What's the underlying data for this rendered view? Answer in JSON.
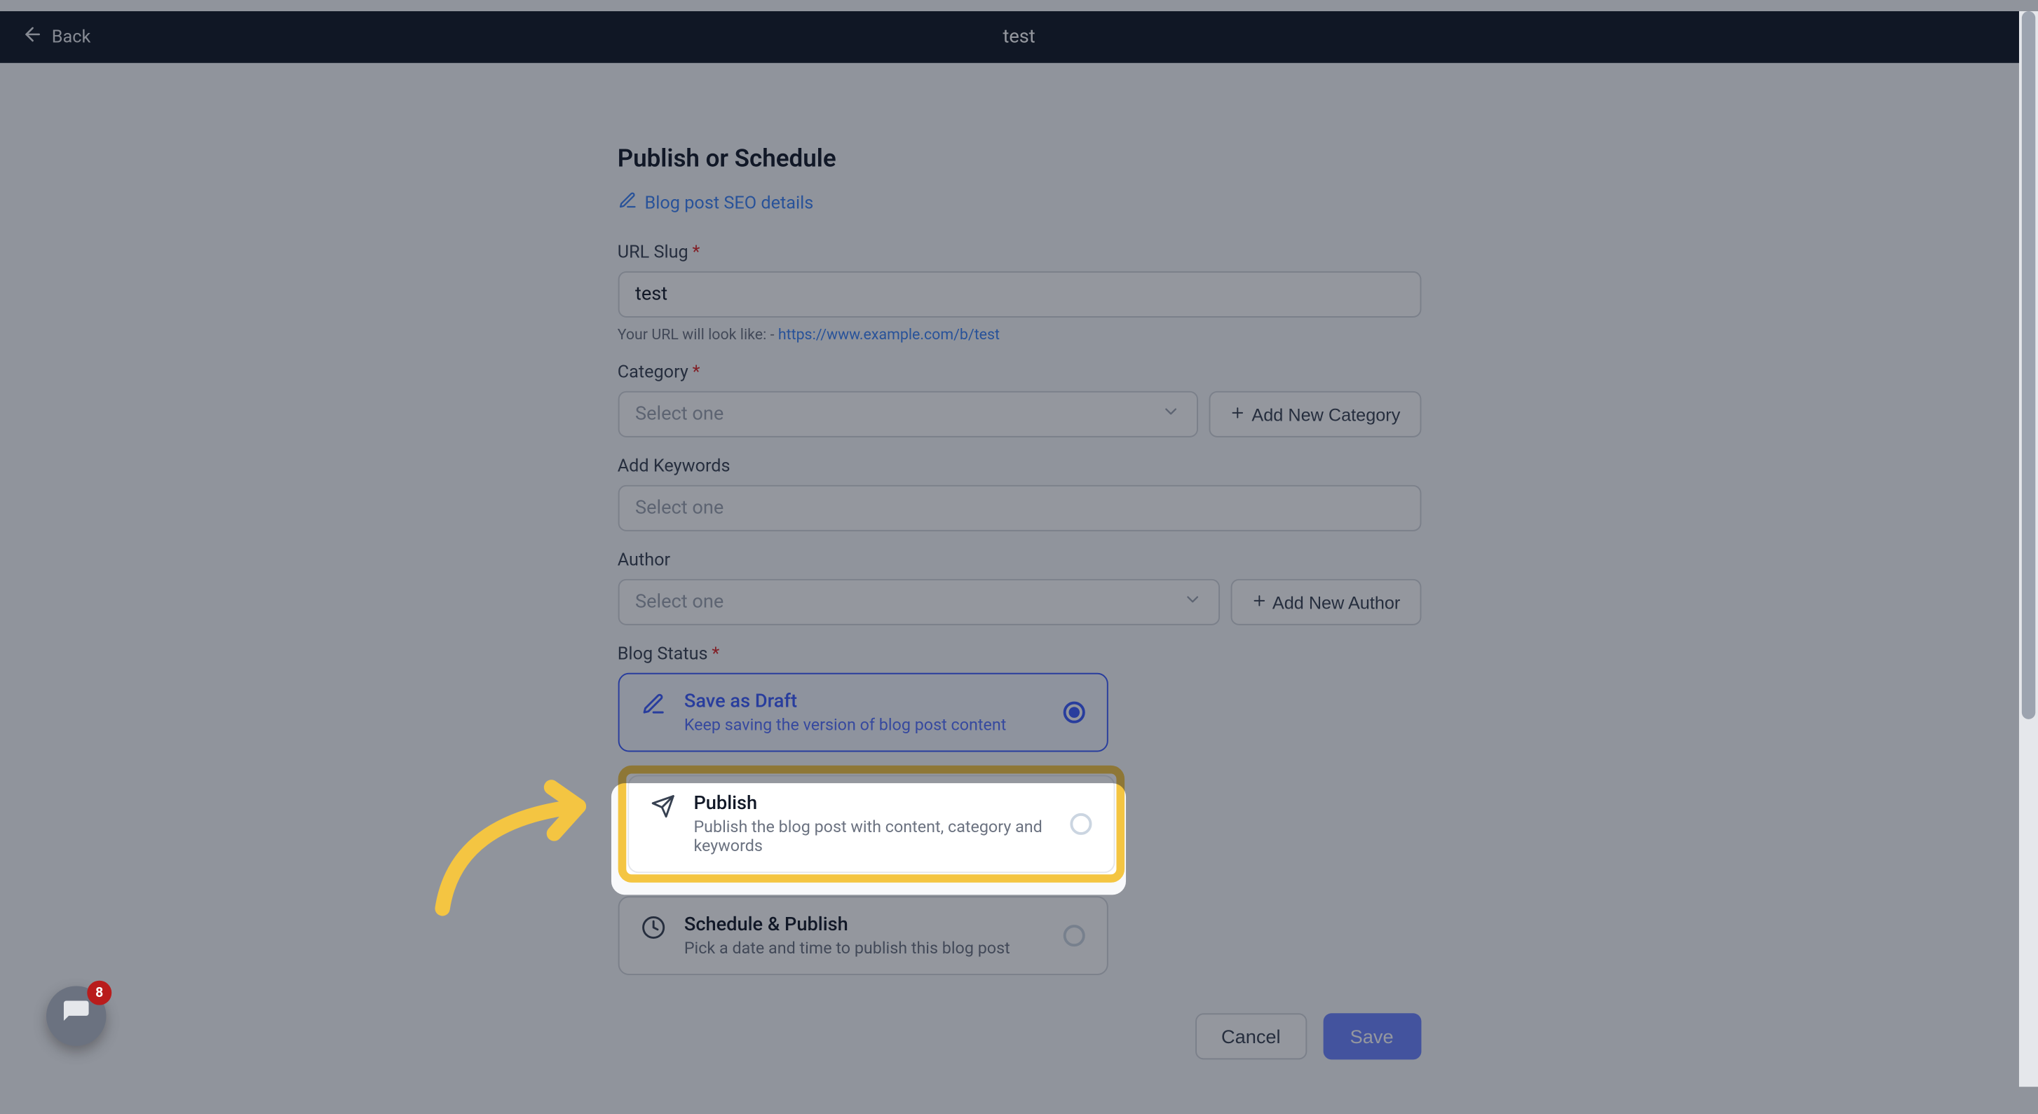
{
  "header": {
    "back_label": "Back",
    "title": "test"
  },
  "page_title": "Publish or Schedule",
  "seo_link": "Blog post SEO details",
  "url_slug": {
    "label": "URL Slug",
    "value": "test",
    "hint_prefix": "Your URL will look like: - ",
    "hint_url": "https://www.example.com/b/test"
  },
  "category": {
    "label": "Category",
    "placeholder": "Select one",
    "add_button": "Add New Category"
  },
  "keywords": {
    "label": "Add Keywords",
    "placeholder": "Select one"
  },
  "author": {
    "label": "Author",
    "placeholder": "Select one",
    "add_button": "Add New Author"
  },
  "blog_status": {
    "label": "Blog Status",
    "options": [
      {
        "title": "Save as Draft",
        "desc": "Keep saving the version of blog post content",
        "selected": true,
        "icon": "pencil"
      },
      {
        "title": "Publish",
        "desc": "Publish the blog post with content, category and keywords",
        "selected": false,
        "icon": "send",
        "highlighted": true
      },
      {
        "title": "Schedule & Publish",
        "desc": "Pick a date and time to publish this blog post",
        "selected": false,
        "icon": "clock"
      }
    ]
  },
  "actions": {
    "cancel": "Cancel",
    "save": "Save"
  },
  "chat": {
    "badge": "8"
  }
}
